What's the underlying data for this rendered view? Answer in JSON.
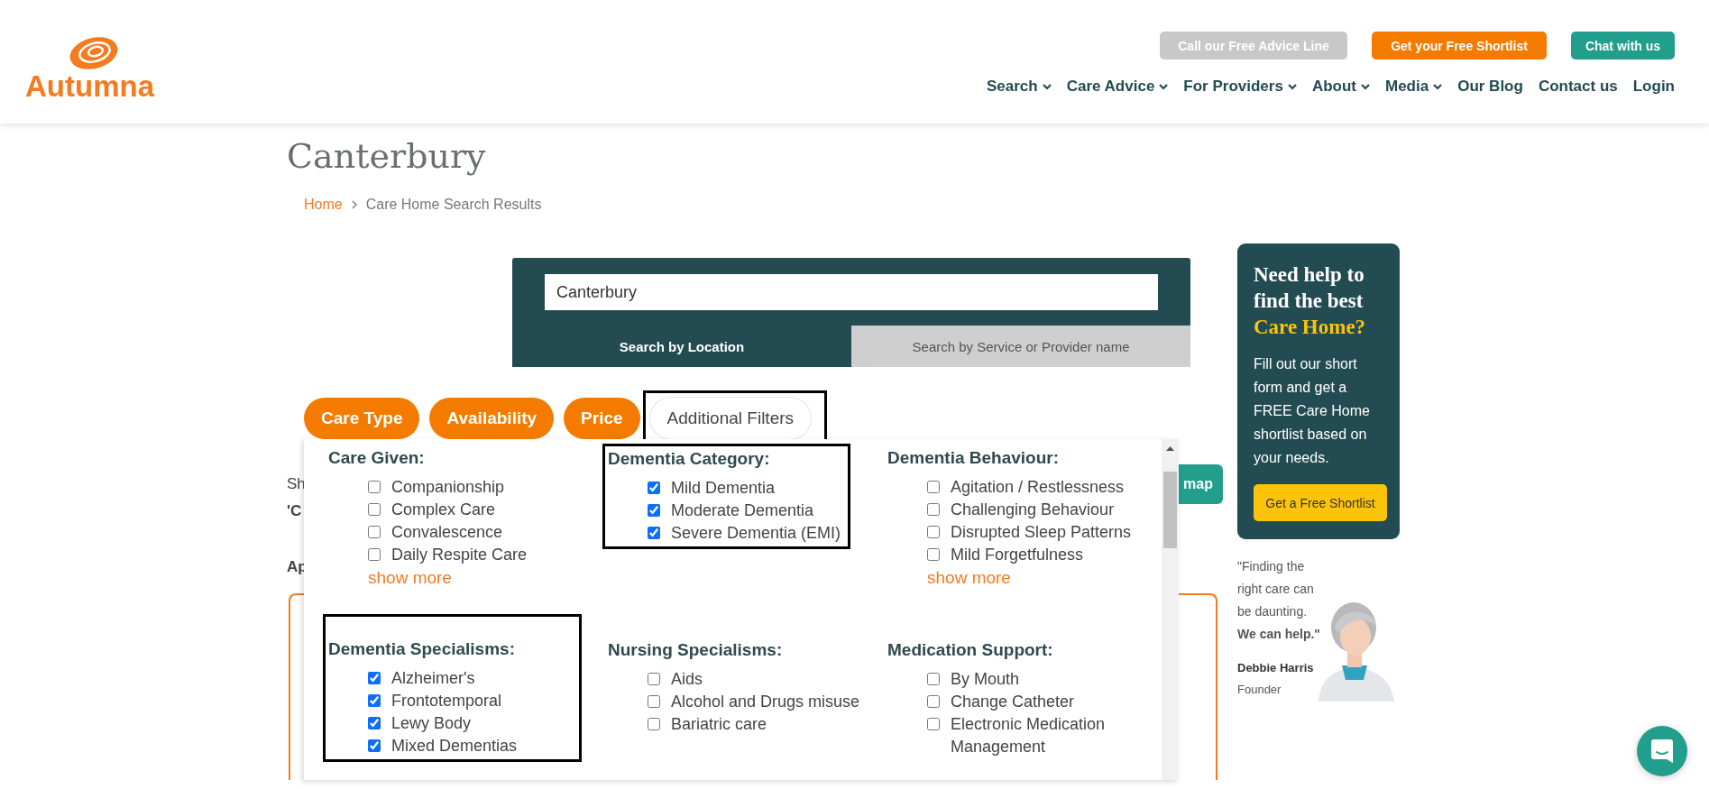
{
  "header": {
    "logo": "Autumna",
    "top_buttons": [
      {
        "label": "Call our Free Advice Line",
        "kind": "grey"
      },
      {
        "label": "Get your Free Shortlist",
        "kind": "orange"
      },
      {
        "label": "Chat with us",
        "kind": "teal"
      }
    ],
    "nav": [
      {
        "label": "Search",
        "dropdown": true
      },
      {
        "label": "Care Advice",
        "dropdown": true
      },
      {
        "label": "For Providers",
        "dropdown": true
      },
      {
        "label": "About",
        "dropdown": true
      },
      {
        "label": "Media",
        "dropdown": true
      },
      {
        "label": "Our Blog",
        "dropdown": false
      },
      {
        "label": "Contact us",
        "dropdown": false
      },
      {
        "label": "Login",
        "dropdown": false
      }
    ]
  },
  "page_title": "Canterbury",
  "breadcrumb": [
    {
      "label": "Home",
      "link": true
    },
    {
      "label": "Care Home Search Results",
      "link": false
    }
  ],
  "search": {
    "value": "Canterbury",
    "tabs": [
      {
        "label": "Search by Location",
        "selected": true
      },
      {
        "label": "Search by Service or Provider name",
        "selected": false
      }
    ]
  },
  "filter_tabs": [
    {
      "label": "Care Type",
      "selected": false,
      "highlighted": false
    },
    {
      "label": "Availability",
      "selected": false,
      "highlighted": false
    },
    {
      "label": "Price",
      "selected": false,
      "highlighted": false
    },
    {
      "label": "Additional Filters",
      "selected": true,
      "highlighted": true
    }
  ],
  "results_fragments": [
    {
      "text": "Sh",
      "bold": false
    },
    {
      "text": "'C",
      "bold": true
    },
    {
      "text": "Ap",
      "bold": true
    }
  ],
  "map_button": "map",
  "filter_sections": [
    {
      "title": "Care Given:",
      "highlighted": false,
      "show_more": "show more",
      "options": [
        {
          "label": "Companionship",
          "checked": false
        },
        {
          "label": "Complex Care",
          "checked": false
        },
        {
          "label": "Convalescence",
          "checked": false
        },
        {
          "label": "Daily Respite Care",
          "checked": false
        }
      ]
    },
    {
      "title": "Dementia Category:",
      "highlighted": true,
      "options": [
        {
          "label": "Mild Dementia",
          "checked": true
        },
        {
          "label": "Moderate Dementia",
          "checked": true
        },
        {
          "label": "Severe Dementia (EMI)",
          "checked": true
        }
      ]
    },
    {
      "title": "Dementia Behaviour:",
      "highlighted": false,
      "show_more": "show more",
      "options": [
        {
          "label": "Agitation / Restlessness",
          "checked": false
        },
        {
          "label": "Challenging Behaviour",
          "checked": false
        },
        {
          "label": "Disrupted Sleep Patterns",
          "checked": false
        },
        {
          "label": "Mild Forgetfulness",
          "checked": false
        }
      ]
    },
    {
      "title": "Dementia Specialisms:",
      "highlighted": true,
      "options": [
        {
          "label": "Alzheimer's",
          "checked": true
        },
        {
          "label": "Frontotemporal",
          "checked": true
        },
        {
          "label": "Lewy Body",
          "checked": true
        },
        {
          "label": "Mixed Dementias",
          "checked": true
        }
      ]
    },
    {
      "title": "Nursing Specialisms:",
      "highlighted": false,
      "options": [
        {
          "label": "Aids",
          "checked": false
        },
        {
          "label": "Alcohol and Drugs misuse",
          "checked": false
        },
        {
          "label": "Bariatric care",
          "checked": false
        }
      ]
    },
    {
      "title": "Medication Support:",
      "highlighted": false,
      "options": [
        {
          "label": "By Mouth",
          "checked": false
        },
        {
          "label": "Change Catheter",
          "checked": false
        },
        {
          "label": "Electronic Medication Management",
          "checked": false
        }
      ]
    }
  ],
  "sidebar": {
    "heading": "Need help to find the best",
    "heading_highlight": "Care Home?",
    "text": "Fill out our short form and get a FREE Care Home shortlist based on your needs.",
    "button": "Get a Free Shortlist",
    "quote": "\"Finding the right care can be daunting. **We can help.\"**",
    "quote_name": "Debbie Harris",
    "quote_role": "Founder"
  }
}
